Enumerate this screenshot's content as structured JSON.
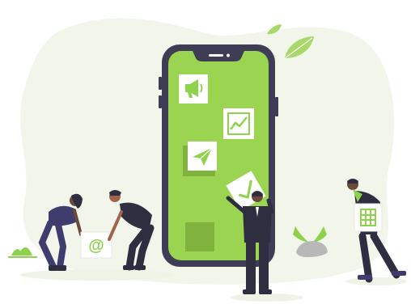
{
  "colors": {
    "background": "#ffffff",
    "blob": "#f1f5ea",
    "phone_frame": "#3f3d56",
    "phone_screen": "#9ad451",
    "accent_green": "#8ed14b",
    "leaf": "#a9d86a",
    "tile_bg": "#ffffff",
    "tile_shadow": "#7fb33e",
    "skin_dark": "#6b4a3a",
    "skin_mid": "#a0644b",
    "clothes_dark": "#2f2e41",
    "clothes_purple": "#3f3d6e",
    "rock": "#b8b8b8"
  },
  "illustration": {
    "phone": {
      "label": "smartphone"
    },
    "tiles": [
      {
        "icon": "megaphone-icon"
      },
      {
        "icon": "line-chart-icon"
      },
      {
        "icon": "paper-plane-icon"
      },
      {
        "icon": "check-icon"
      },
      {
        "icon": "blank-tile"
      }
    ],
    "cards": [
      {
        "icon": "at-sign-icon"
      },
      {
        "icon": "spreadsheet-icon"
      }
    ],
    "people_count": 4,
    "decorations": [
      "leaf-icon",
      "leaf-icon",
      "plant-icon",
      "plant-icon",
      "rock-icon"
    ]
  }
}
